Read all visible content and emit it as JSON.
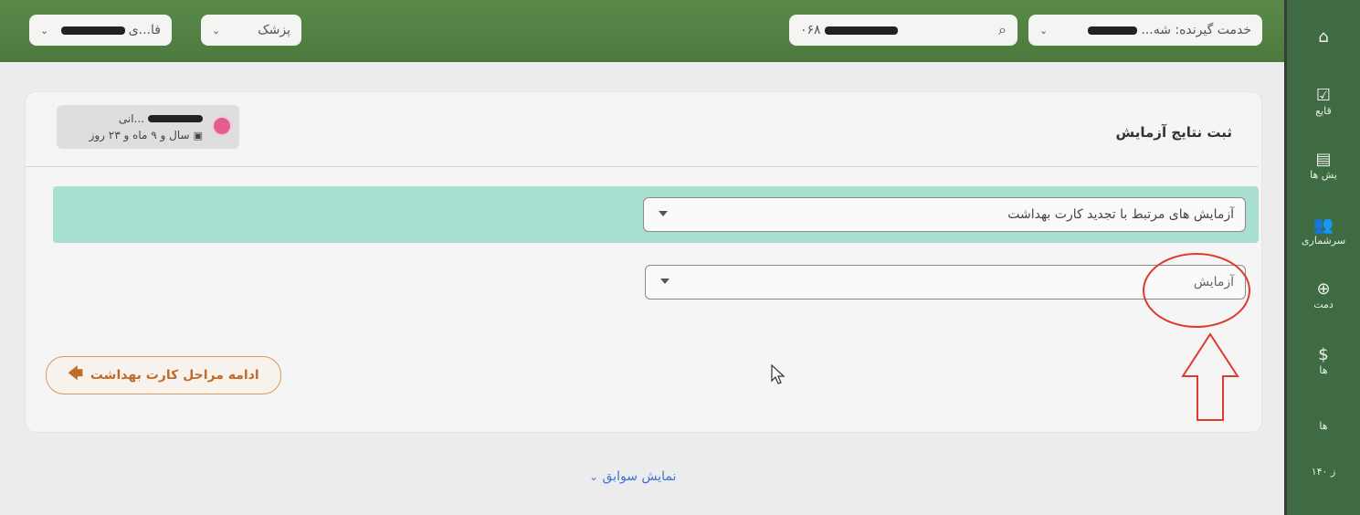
{
  "topbar": {
    "patient_filter_label": "فا...ی",
    "role_label": "پزشک",
    "search_value": "۰۶۸",
    "service_recipient_label": "خدمت گیرنده: شه..."
  },
  "sidebar": {
    "items": [
      {
        "label": "",
        "icon": "home-icon"
      },
      {
        "label": "قایع",
        "icon": "calendar-check-icon"
      },
      {
        "label": "یش ها",
        "icon": "document-icon"
      },
      {
        "label": "سرشماری",
        "icon": "people-icon"
      },
      {
        "label": "دمت",
        "icon": "globe-icon"
      },
      {
        "label": "ها",
        "icon": "coin-icon"
      },
      {
        "label": "ها",
        "icon": "list-icon"
      },
      {
        "label": "ز ۱۴۰",
        "icon": "calendar-icon"
      }
    ]
  },
  "page": {
    "title": "ثبت نتایج آزمایش",
    "patient_name": "...انی",
    "patient_age": "سال و ۹ ماه و ۲۳ روز",
    "test_group_select_value": "آزمایش های مرتبط با تجدید کارت بهداشت",
    "test_select_placeholder": "آزمایش",
    "continue_button_label": "ادامه مراحل کارت بهداشت",
    "show_history_label": "نمایش سوابق"
  },
  "colors": {
    "topbar": "#4c7a3e",
    "sidebar": "#3f6b42",
    "band": "#a9dfd1",
    "accent_orange": "#c06b2a",
    "link_blue": "#3c73d6",
    "annotation_red": "#e03a2f"
  }
}
